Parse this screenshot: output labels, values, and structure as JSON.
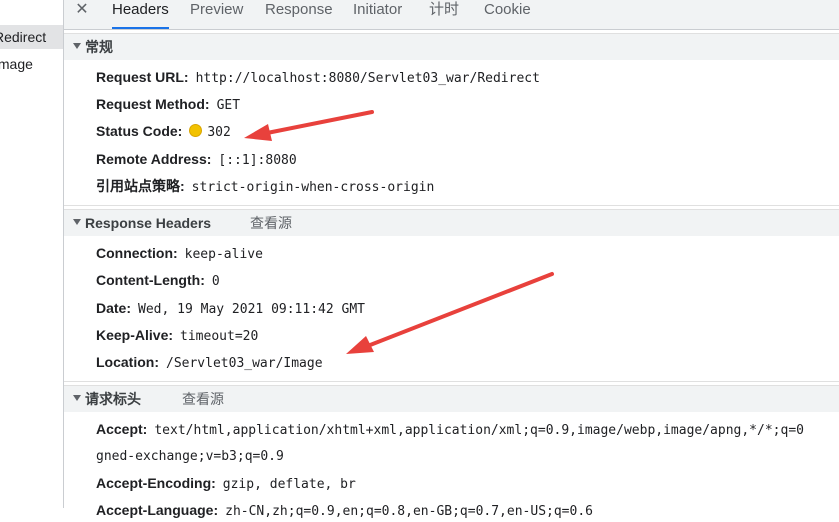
{
  "left_panel": {
    "items": [
      {
        "label": "Redirect",
        "selected": true
      },
      {
        "label": "Image",
        "selected": false
      }
    ]
  },
  "tabs": {
    "close_symbol": "✕",
    "items": [
      "Headers",
      "Preview",
      "Response",
      "Initiator",
      "计时",
      "Cookie"
    ],
    "active": "Headers"
  },
  "general": {
    "title": "常规",
    "request_url": {
      "key": "Request URL:",
      "value": "http://localhost:8080/Servlet03_war/Redirect"
    },
    "request_method": {
      "key": "Request Method:",
      "value": "GET"
    },
    "status_code": {
      "key": "Status Code:",
      "value": "302",
      "status_color": "#f2c200"
    },
    "remote_address": {
      "key": "Remote Address:",
      "value": "[::1]:8080"
    },
    "referrer_policy": {
      "key": "引用站点策略:",
      "value": "strict-origin-when-cross-origin"
    }
  },
  "response_headers": {
    "title": "Response Headers",
    "view_source": "查看源",
    "items": [
      {
        "key": "Connection:",
        "value": "keep-alive"
      },
      {
        "key": "Content-Length:",
        "value": "0"
      },
      {
        "key": "Date:",
        "value": "Wed, 19 May 2021 09:11:42 GMT"
      },
      {
        "key": "Keep-Alive:",
        "value": "timeout=20"
      },
      {
        "key": "Location:",
        "value": "/Servlet03_war/Image"
      }
    ]
  },
  "request_headers": {
    "title": "请求标头",
    "view_source": "查看源",
    "accept": {
      "key": "Accept:",
      "value": "text/html,application/xhtml+xml,application/xml;q=0.9,image/webp,image/apng,*/*;q=0",
      "continuation": "gned-exchange;v=b3;q=0.9"
    },
    "accept_encoding": {
      "key": "Accept-Encoding:",
      "value": "gzip, deflate, br"
    },
    "accept_language": {
      "key": "Accept-Language:",
      "value": "zh-CN,zh;q=0.9,en;q=0.8,en-GB;q=0.7,en-US;q=0.6"
    }
  },
  "annotation_color": "#e8413c"
}
